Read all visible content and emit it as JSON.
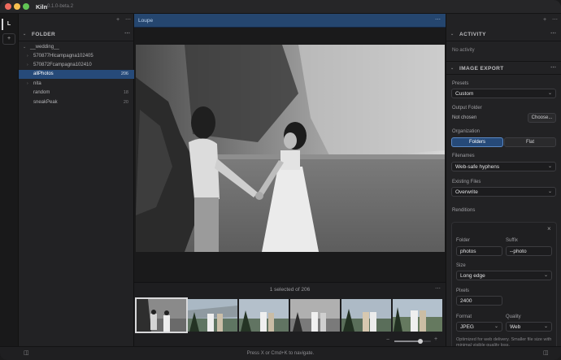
{
  "app": {
    "name": "Kiln",
    "version": "0.1.0-beta.2"
  },
  "colors": {
    "accent": "#264a79",
    "close": "#ed6a5e",
    "minimize": "#f5bf4f",
    "zoom": "#61c554",
    "background": "#1e1e20"
  },
  "rail": {
    "mode_label": "L",
    "add_label": "+"
  },
  "left_panel": {
    "section_title": "FOLDER",
    "root": "__wedding__",
    "folders": [
      {
        "label": "570877Hlcampagna102405",
        "count": "",
        "expandable": true
      },
      {
        "label": "570872Fcampagna102410",
        "count": "",
        "expandable": true
      },
      {
        "label": "allPhotos",
        "count": "206",
        "selected": true
      },
      {
        "label": "nita",
        "count": "",
        "expandable": true
      },
      {
        "label": "random",
        "count": "18"
      },
      {
        "label": "sneakPeak",
        "count": "20"
      }
    ]
  },
  "center": {
    "tab_label": "Loupe",
    "selection_info": "1 selected of 206",
    "thumbnail_count": 6,
    "zoom_fraction": 0.72
  },
  "right_panel": {
    "activity": {
      "title": "ACTIVITY",
      "empty_text": "No activity"
    },
    "export": {
      "title": "IMAGE EXPORT",
      "presets_label": "Presets",
      "presets_value": "Custom",
      "output_label": "Output Folder",
      "output_value": "Not chosen",
      "choose_label": "Choose...",
      "organization_label": "Organization",
      "org_options": [
        "Folders",
        "Flat"
      ],
      "org_selected": "Folders",
      "filenames_label": "Filenames",
      "filenames_value": "Web-safe hyphens",
      "existing_label": "Existing Files",
      "existing_value": "Overwrite",
      "renditions_label": "Renditions",
      "rendition": {
        "folder_label": "Folder",
        "folder_value": "photos",
        "suffix_label": "Suffix",
        "suffix_value": "--photo",
        "size_label": "Size",
        "size_value": "Long edge",
        "pixels_label": "Pixels",
        "pixels_value": "2400",
        "format_label": "Format",
        "format_value": "JPEG",
        "quality_label": "Quality",
        "quality_value": "Web",
        "note": "Optimized for web delivery. Smaller file size with minimal visible quality loss."
      }
    }
  },
  "statusbar": {
    "hint": "Press X or Cmd+K to navigate."
  }
}
